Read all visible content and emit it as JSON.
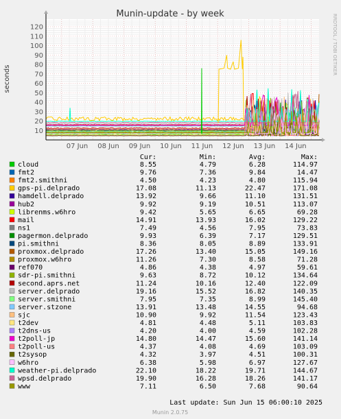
{
  "title": "Munin-update - by week",
  "ylabel": "seconds",
  "side_label": "RRDTOOL / TOBI OETIKER",
  "footer": "Munin 2.0.75",
  "last_update": "Last update: Sun Jun 15 06:00:10 2025",
  "legend_headers": [
    "Cur:",
    "Min:",
    "Avg:",
    "Max:"
  ],
  "chart_data": {
    "type": "line",
    "title": "Munin-update - by week",
    "xlabel": "",
    "ylabel": "seconds",
    "x_ticks": [
      "07 Jun",
      "08 Jun",
      "09 Jun",
      "10 Jun",
      "11 Jun",
      "12 Jun",
      "13 Jun",
      "14 Jun"
    ],
    "x_range": [
      "2025-06-06T12:00",
      "2025-06-15T06:00"
    ],
    "y_ticks": [
      10,
      20,
      30,
      40,
      50,
      60,
      70,
      80,
      90,
      100,
      110,
      120
    ],
    "ylim": [
      0,
      128
    ],
    "grid": true,
    "legend_position": "bottom",
    "series": [
      {
        "name": "cloud",
        "color": "#00cc00",
        "cur": "8.55",
        "min": "4.79",
        "avg": "6.28",
        "max": "114.97"
      },
      {
        "name": "fmt2",
        "color": "#0066b3",
        "cur": "9.76",
        "min": "7.36",
        "avg": "9.84",
        "max": "14.47"
      },
      {
        "name": "fmt2.smithni",
        "color": "#ff8000",
        "cur": "4.50",
        "min": "4.23",
        "avg": "4.80",
        "max": "115.94"
      },
      {
        "name": "gps-pi.delprado",
        "color": "#ffcc00",
        "cur": "17.08",
        "min": "11.13",
        "avg": "22.47",
        "max": "171.08"
      },
      {
        "name": "hamdell.delprado",
        "color": "#330099",
        "cur": "13.92",
        "min": "9.66",
        "avg": "11.10",
        "max": "131.51"
      },
      {
        "name": "hub2",
        "color": "#990099",
        "cur": "9.92",
        "min": "9.19",
        "avg": "10.51",
        "max": "113.07"
      },
      {
        "name": "librenms.w6hro",
        "color": "#ccff00",
        "cur": "9.42",
        "min": "5.65",
        "avg": "6.65",
        "max": "69.28"
      },
      {
        "name": "mail",
        "color": "#ff0000",
        "cur": "14.91",
        "min": "13.93",
        "avg": "16.02",
        "max": "129.22"
      },
      {
        "name": "ns1",
        "color": "#808080",
        "cur": "7.49",
        "min": "4.56",
        "avg": "7.95",
        "max": "73.83"
      },
      {
        "name": "pagermon.delprado",
        "color": "#008f00",
        "cur": "9.93",
        "min": "6.39",
        "avg": "7.17",
        "max": "129.51"
      },
      {
        "name": "pi.smithni",
        "color": "#00487d",
        "cur": "8.36",
        "min": "8.05",
        "avg": "8.89",
        "max": "133.91"
      },
      {
        "name": "proxmox.delprado",
        "color": "#b35a00",
        "cur": "17.26",
        "min": "13.40",
        "avg": "15.05",
        "max": "149.16"
      },
      {
        "name": "proxmox.w6hro",
        "color": "#b38f00",
        "cur": "11.26",
        "min": "7.30",
        "avg": "8.58",
        "max": "71.28"
      },
      {
        "name": "ref070",
        "color": "#6b006b",
        "cur": "4.86",
        "min": "4.38",
        "avg": "4.97",
        "max": "59.61"
      },
      {
        "name": "sdr-pi.smithni",
        "color": "#8fb300",
        "cur": "9.63",
        "min": "8.72",
        "avg": "10.12",
        "max": "134.64"
      },
      {
        "name": "second.aprs.net",
        "color": "#b30000",
        "cur": "11.24",
        "min": "10.16",
        "avg": "12.40",
        "max": "122.09"
      },
      {
        "name": "server.delprado",
        "color": "#bebebe",
        "cur": "19.16",
        "min": "15.52",
        "avg": "16.82",
        "max": "140.35"
      },
      {
        "name": "server.smithni",
        "color": "#80ff80",
        "cur": "7.95",
        "min": "7.35",
        "avg": "8.99",
        "max": "145.40"
      },
      {
        "name": "server.stzone",
        "color": "#80c9ff",
        "cur": "13.91",
        "min": "13.48",
        "avg": "14.55",
        "max": "94.68"
      },
      {
        "name": "sjc",
        "color": "#ffc080",
        "cur": "10.90",
        "min": "9.92",
        "avg": "11.54",
        "max": "123.43"
      },
      {
        "name": "t2dev",
        "color": "#ffe680",
        "cur": "4.81",
        "min": "4.48",
        "avg": "5.11",
        "max": "103.83"
      },
      {
        "name": "t2dns-us",
        "color": "#aa80ff",
        "cur": "4.20",
        "min": "4.00",
        "avg": "4.59",
        "max": "102.28"
      },
      {
        "name": "t2poll-jp",
        "color": "#ee00cc",
        "cur": "14.80",
        "min": "14.47",
        "avg": "15.60",
        "max": "141.14"
      },
      {
        "name": "t2poll-us",
        "color": "#ff8080",
        "cur": "4.37",
        "min": "4.08",
        "avg": "4.69",
        "max": "103.09"
      },
      {
        "name": "t2sysop",
        "color": "#666600",
        "cur": "4.32",
        "min": "3.97",
        "avg": "4.51",
        "max": "100.31"
      },
      {
        "name": "w6hro",
        "color": "#ffbfff",
        "cur": "6.38",
        "min": "5.98",
        "avg": "6.97",
        "max": "127.67"
      },
      {
        "name": "weather-pi.delprado",
        "color": "#00ffcc",
        "cur": "22.10",
        "min": "18.22",
        "avg": "19.71",
        "max": "144.67"
      },
      {
        "name": "wpsd.delprado",
        "color": "#cc6699",
        "cur": "19.90",
        "min": "16.28",
        "avg": "18.26",
        "max": "141.17"
      },
      {
        "name": "www",
        "color": "#999900",
        "cur": "7.11",
        "min": "6.50",
        "avg": "7.68",
        "max": "90.64"
      }
    ]
  }
}
